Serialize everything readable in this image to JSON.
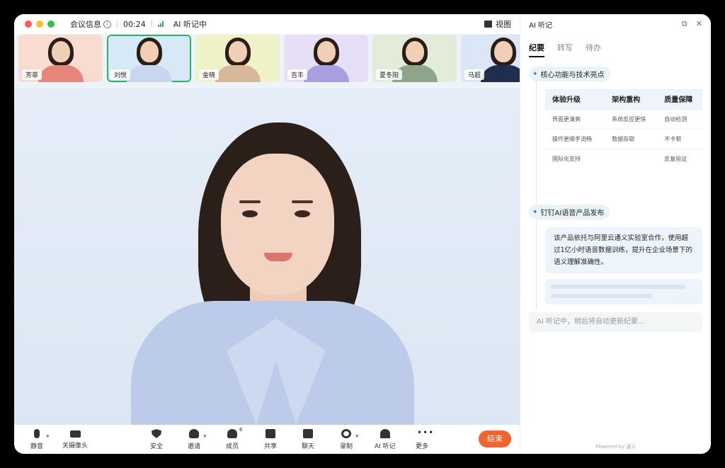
{
  "titlebar": {
    "meeting_info": "会议信息",
    "info_icon": "i",
    "timer": "00:24",
    "ai_status": "AI 听记中",
    "view_label": "视图"
  },
  "participants": [
    {
      "name": "芳菲",
      "bg": "#f8dcd0",
      "shirt": "#e8857a"
    },
    {
      "name": "刘悦",
      "bg": "#d7e8f7",
      "shirt": "#c8d6f0",
      "active": true
    },
    {
      "name": "金晓",
      "bg": "#eef2c6",
      "shirt": "#d8b89a"
    },
    {
      "name": "吉丰",
      "bg": "#e6dff5",
      "shirt": "#a99ee0"
    },
    {
      "name": "夏冬阳",
      "bg": "#e2ecd9",
      "shirt": "#8ea58a"
    },
    {
      "name": "马超",
      "bg": "#dbe6f6",
      "shirt": "#1f2d4f"
    }
  ],
  "toolbar": {
    "mute": "静音",
    "camera_off": "关摄像头",
    "security": "安全",
    "invite": "邀请",
    "members": "成员",
    "members_count": "6",
    "share": "共享",
    "chat": "聊天",
    "record": "录制",
    "ai_notes": "AI 听记",
    "more": "更多",
    "more_glyph": "•••",
    "end": "结束"
  },
  "panel": {
    "title": "AI 听记",
    "tabs": [
      "纪要",
      "转写",
      "待办"
    ],
    "active_tab": "纪要",
    "topic1": "核心功能与技术亮点",
    "table": {
      "headers": [
        "体验升级",
        "架构重构",
        "质量保障"
      ],
      "rows": [
        [
          "界面更清爽",
          "系统反应更快",
          "自动检测"
        ],
        [
          "操作更顺手流畅",
          "数据存取",
          "不卡顿"
        ],
        [
          "国际化支持",
          "",
          "反复验证"
        ]
      ]
    },
    "topic2": "钉钉AI语音产品发布",
    "paragraph": "该产品依托与阿里云通义实验室合作，使用超过1亿小时语音数据训练，提升在企业场景下的语义理解准确性。",
    "status": "AI 听记中，稍后将自动更新纪要...",
    "powered": "Powered by 通义"
  },
  "colors": {
    "accent_green": "#28b463",
    "end_button": "#f2642c",
    "spark_blue": "#2b6fd6"
  }
}
